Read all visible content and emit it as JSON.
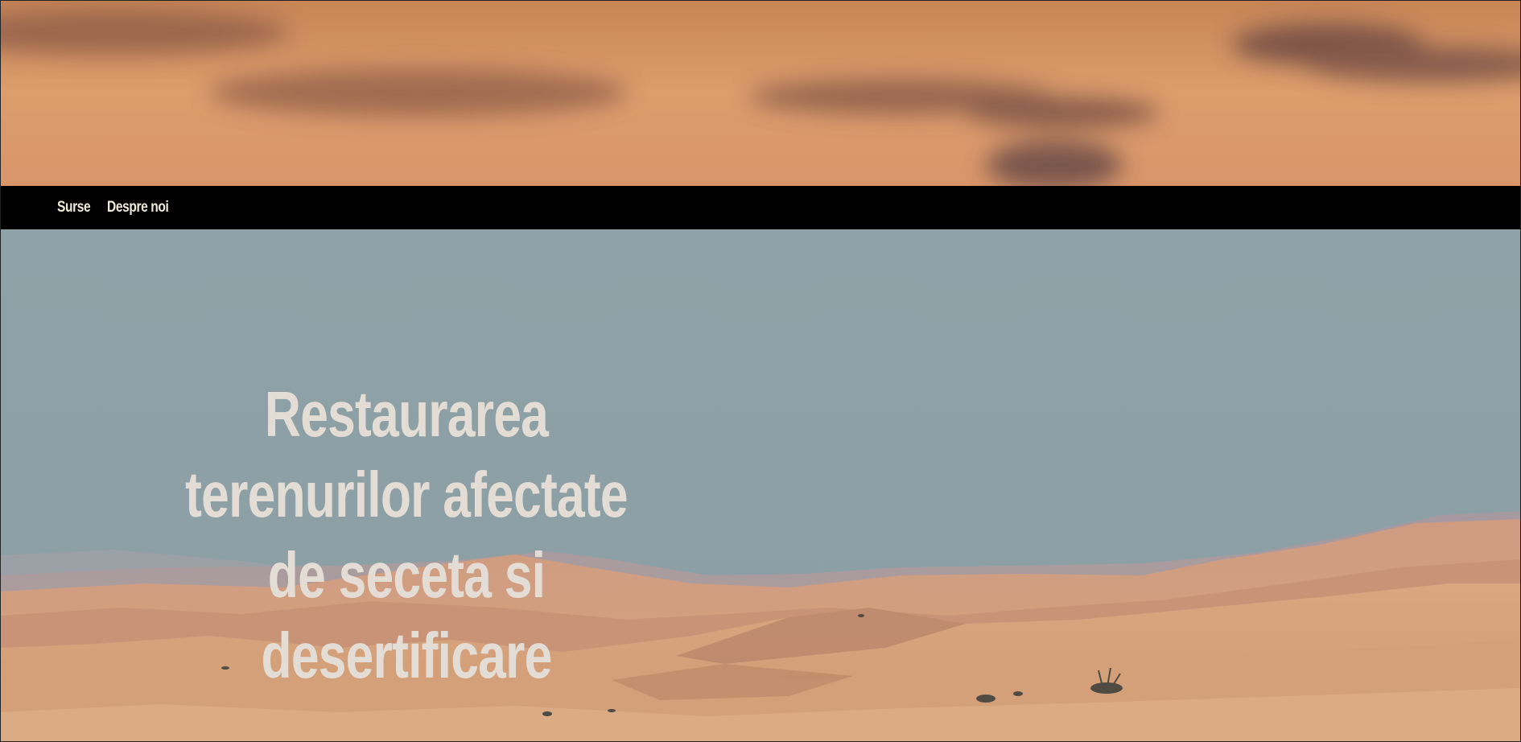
{
  "nav": {
    "items": [
      {
        "label": "Surse"
      },
      {
        "label": "Despre noi"
      }
    ]
  },
  "hero": {
    "title": "Restaurarea terenurilor afectate de seceta si desertificare"
  },
  "colors": {
    "nav_background": "#000000",
    "nav_text": "#f1ead8",
    "hero_title": "#e4ddd5",
    "sky": "#8fa3a8",
    "sunset": "#d99a68",
    "dunes": "#d29a78"
  }
}
